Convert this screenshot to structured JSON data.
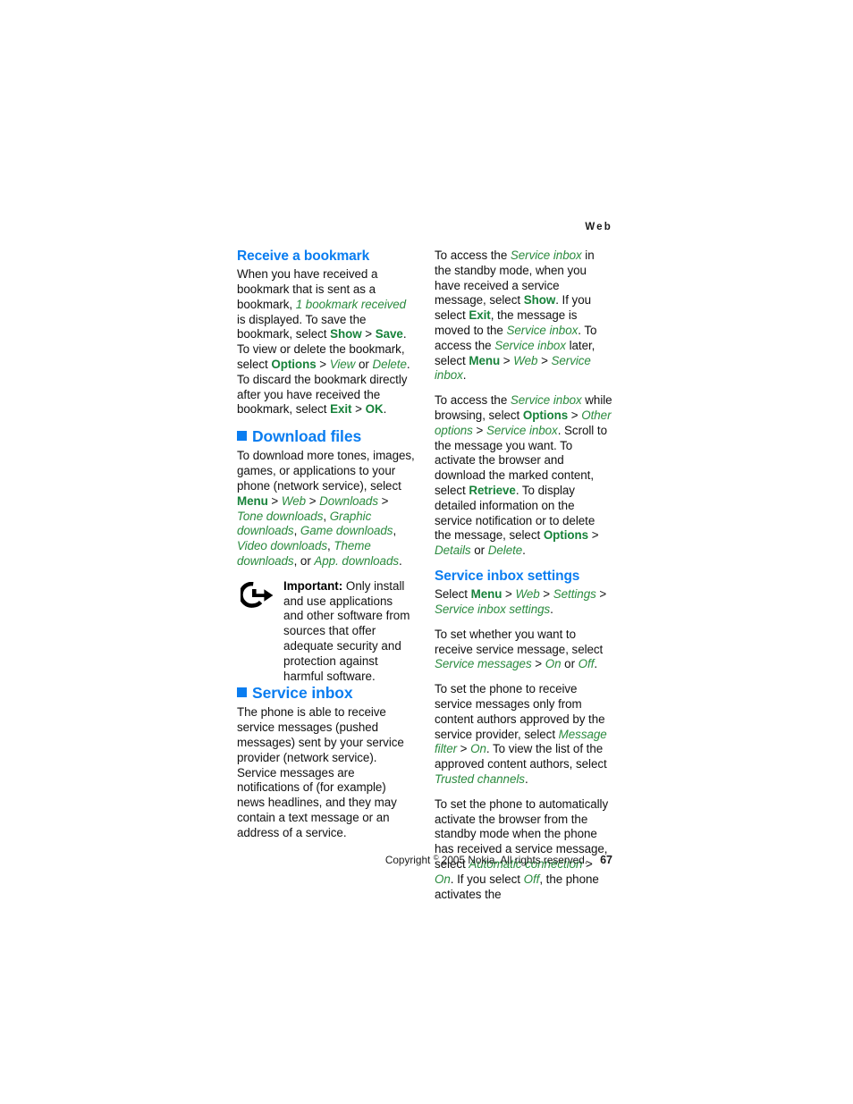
{
  "running_head": "Web",
  "colors": {
    "heading_blue": "#0a7df0",
    "command_green": "#17823a",
    "italic_green": "#2a8a3e",
    "body_text": "#111111"
  },
  "left_column": {
    "sub_heading_1": "Receive a bookmark",
    "para_1": {
      "t1": "When you have received a bookmark that is sent as a bookmark, ",
      "i1": "1 bookmark received",
      "t2": " is displayed. To save the bookmark, select ",
      "b1": "Show",
      "gt1": " > ",
      "b2": "Save",
      "t3": ". To view or delete the bookmark, select ",
      "b3": "Options",
      "gt2": " > ",
      "i2": "View",
      "t4": " or ",
      "i3": "Delete",
      "t5": ". To discard the bookmark directly after you have received the bookmark, select ",
      "b4": "Exit",
      "gt3": " > ",
      "b5": "OK",
      "t6": "."
    },
    "section_heading_1": "Download files",
    "para_2": {
      "t1": "To download more tones, images, games, or applications to your phone (network service), select ",
      "b1": "Menu",
      "gt1": " > ",
      "i1": "Web",
      "gt2": " > ",
      "i2": "Downloads",
      "gt3": " > ",
      "i3": "Tone downloads",
      "t2": ", ",
      "i4": "Graphic downloads",
      "t3": ", ",
      "i5": "Game downloads",
      "t4": ", ",
      "i6": "Video downloads",
      "t5": ", ",
      "i7": "Theme downloads",
      "t6": ", or ",
      "i8": "App. downloads",
      "t7": "."
    },
    "note": {
      "icon": "important-arrow-icon",
      "lead": "Important:",
      "text": " Only install and use applications and other software from sources that offer adequate security and protection against harmful software."
    },
    "section_heading_2": "Service inbox",
    "para_3": "The phone is able to receive service messages (pushed messages) sent by your service provider (network service). Service messages are notifications of (for example) news headlines, and they may contain a text message or an address of a service."
  },
  "right_column": {
    "para_1": {
      "t1": "To access the ",
      "i1": "Service inbox",
      "t2": " in the standby mode, when you have received a service message, select ",
      "b1": "Show",
      "t3": ". If you select ",
      "b2": "Exit",
      "t4": ", the message is moved to the ",
      "i2": "Service inbox",
      "t5": ". To access the ",
      "i3": "Service inbox",
      "t6": " later, select ",
      "b3": "Menu",
      "gt1": " > ",
      "i4": "Web",
      "gt2": " > ",
      "i5": "Service inbox",
      "t7": "."
    },
    "para_2": {
      "t1": "To access the ",
      "i1": "Service inbox",
      "t2": " while browsing, select ",
      "b1": "Options",
      "gt1": " > ",
      "i2": "Other options",
      "gt2": " > ",
      "i3": "Service inbox",
      "t3": ". Scroll to the message you want. To activate the browser and download the marked content, select ",
      "b2": "Retrieve",
      "t4": ". To display detailed information on the service notification or to delete the message, select ",
      "b3": "Options",
      "gt3": " > ",
      "i4": "Details",
      "t5": " or ",
      "i5": "Delete",
      "t6": "."
    },
    "sub_heading_1": "Service inbox settings",
    "para_3": {
      "t1": "Select ",
      "b1": "Menu",
      "gt1": " > ",
      "i1": "Web",
      "gt2": " > ",
      "i2": "Settings",
      "gt3": " > ",
      "i3": "Service inbox settings",
      "t2": "."
    },
    "para_4": {
      "t1": "To set whether you want to receive service message, select ",
      "i1": "Service messages",
      "gt1": " > ",
      "i2": "On",
      "t2": " or ",
      "i3": "Off",
      "t3": "."
    },
    "para_5": {
      "t1": "To set the phone to receive service messages only from content authors approved by the service provider, select ",
      "i1": "Message filter",
      "gt1": " > ",
      "i2": "On",
      "t2": ". To view the list of the approved content authors, select ",
      "i3": "Trusted channels",
      "t3": "."
    },
    "para_6": {
      "t1": "To set the phone to automatically activate the browser from the standby mode when the phone has received a service message, select ",
      "i1": "Automatic connection",
      "gt1": " > ",
      "i2": "On",
      "t2": ". If you select ",
      "i3": "Off",
      "t3": ", the phone activates the"
    }
  },
  "footer": {
    "copyright_pre": "Copyright ",
    "copyright_symbol": "©",
    "copyright_post": " 2005 Nokia. All rights reserved.",
    "page_number": "67"
  }
}
